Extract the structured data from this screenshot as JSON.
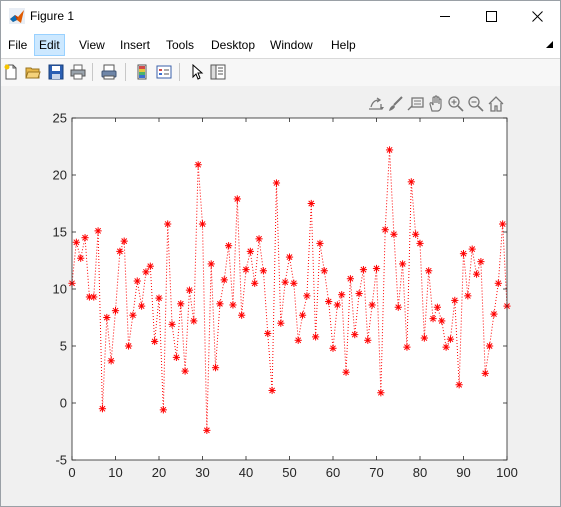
{
  "window": {
    "title": "Figure 1",
    "icon": "matlab-logo-icon"
  },
  "menubar": {
    "items": [
      "File",
      "Edit",
      "View",
      "Insert",
      "Tools",
      "Desktop",
      "Window",
      "Help"
    ],
    "active_item": "Edit"
  },
  "toolbar": {
    "buttons": [
      "new-figure-icon",
      "open-file-icon",
      "save-icon",
      "print-icon",
      "link-plot-icon",
      "insert-colorbar-icon",
      "insert-legend-icon",
      "edit-plot-arrow-icon",
      "property-inspector-icon"
    ]
  },
  "axes_toolbar": {
    "buttons": [
      "export-icon",
      "brush-icon",
      "data-tips-icon",
      "pan-icon",
      "zoom-in-icon",
      "zoom-out-icon",
      "home-icon"
    ]
  },
  "colors": {
    "series": "#ff0000",
    "axes_bg": "#ffffff",
    "figure_bg": "#f0f0f0",
    "axis_line": "#262626"
  },
  "chart_data": {
    "type": "line",
    "line_style": "dotted",
    "marker": "asterisk",
    "title": "",
    "xlabel": "",
    "ylabel": "",
    "xlim": [
      0,
      100
    ],
    "ylim": [
      -5,
      25
    ],
    "xticks": [
      0,
      10,
      20,
      30,
      40,
      50,
      60,
      70,
      80,
      90,
      100
    ],
    "yticks": [
      -5,
      0,
      5,
      10,
      15,
      20,
      25
    ],
    "grid": false,
    "series": [
      {
        "x": [
          0,
          1,
          2,
          3,
          4,
          5,
          6,
          7,
          8,
          9,
          10,
          11,
          12,
          13,
          14,
          15,
          16,
          17,
          18,
          19,
          20,
          21,
          22,
          23,
          24,
          25,
          26,
          27,
          28,
          29,
          30,
          31,
          32,
          33,
          34,
          35,
          36,
          37,
          38,
          39,
          40,
          41,
          42,
          43,
          44,
          45,
          46,
          47,
          48,
          49,
          50,
          51,
          52,
          53,
          54,
          55,
          56,
          57,
          58,
          59,
          60,
          61,
          62,
          63,
          64,
          65,
          66,
          67,
          68,
          69,
          70,
          71,
          72,
          73,
          74,
          75,
          76,
          77,
          78,
          79,
          80,
          81,
          82,
          83,
          84,
          85,
          86,
          87,
          88,
          89,
          90,
          91,
          92,
          93,
          94,
          95,
          96,
          97,
          98,
          99,
          100
        ],
        "y": [
          10.5,
          14.1,
          12.7,
          14.5,
          9.3,
          9.3,
          15.1,
          -0.5,
          7.5,
          3.7,
          8.1,
          13.3,
          14.2,
          5.0,
          7.7,
          10.7,
          8.5,
          11.5,
          12.0,
          5.4,
          9.2,
          -0.6,
          15.7,
          6.9,
          4.0,
          8.7,
          2.8,
          9.9,
          7.2,
          20.9,
          15.7,
          -2.4,
          12.2,
          3.1,
          8.7,
          10.8,
          13.8,
          8.6,
          17.9,
          7.7,
          11.7,
          13.3,
          10.5,
          14.4,
          11.6,
          6.1,
          1.1,
          19.3,
          7.0,
          10.6,
          12.8,
          10.5,
          5.5,
          7.7,
          9.4,
          17.5,
          5.8,
          14.0,
          11.6,
          8.9,
          4.8,
          8.6,
          9.5,
          2.7,
          10.9,
          6.0,
          9.6,
          11.7,
          5.5,
          8.6,
          11.8,
          0.9,
          15.2,
          22.2,
          14.8,
          8.4,
          12.2,
          4.9,
          19.4,
          14.8,
          14.0,
          5.7,
          11.6,
          7.4,
          8.4,
          7.2,
          4.9,
          5.6,
          9.0,
          1.6,
          13.1,
          9.4,
          13.5,
          11.3,
          12.4,
          2.6,
          5.0,
          7.8,
          10.5,
          15.7,
          8.5
        ]
      }
    ]
  }
}
